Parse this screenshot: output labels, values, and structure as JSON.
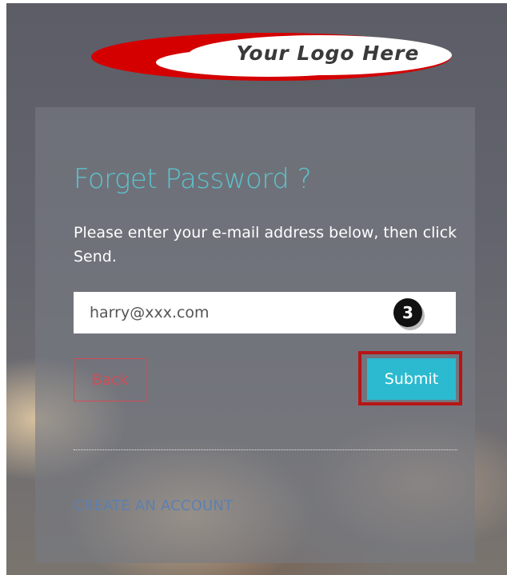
{
  "logo": {
    "text": "Your Logo Here",
    "colors": {
      "swoosh": "#d40000",
      "oval": "#ffffff",
      "text": "#3a3a3a"
    }
  },
  "form": {
    "title": "Forget Password ?",
    "instruction": "Please enter your e-mail address below, then click Send.",
    "email_value": "harry@xxx.com",
    "step_marker": "3",
    "back_label": "Back",
    "submit_label": "Submit",
    "create_account_label": "CREATE AN ACCOUNT"
  },
  "colors": {
    "title": "#5cc3cc",
    "back_button": "#d24c58",
    "submit_button": "#2bbad0",
    "highlight": "#b81414",
    "link": "#5d7fb0"
  }
}
